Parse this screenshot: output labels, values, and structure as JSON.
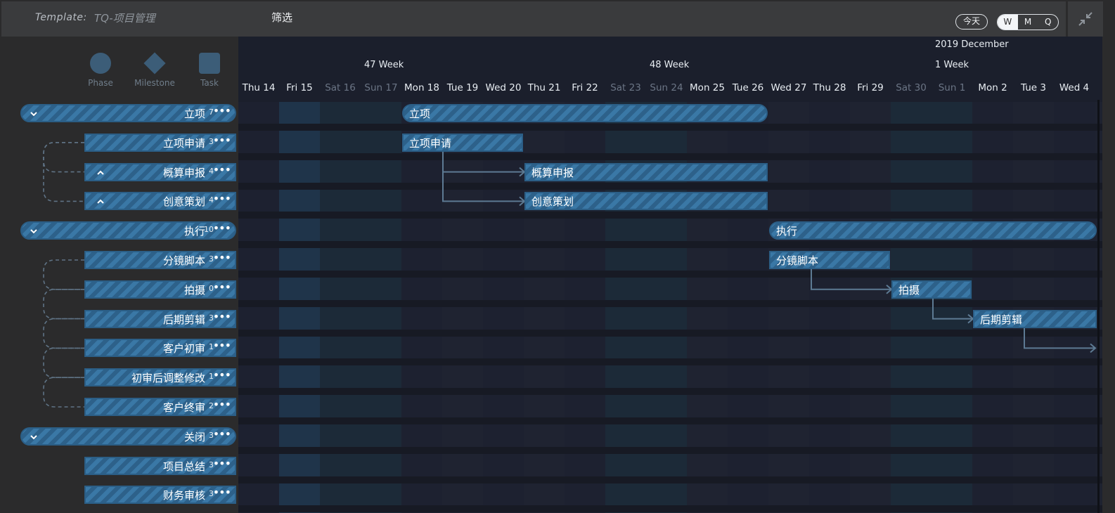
{
  "topbar": {
    "template_label": "Template:",
    "template_name": "TQ-项目管理",
    "filter_label": "筛选",
    "today_label": "今天",
    "view_modes": [
      "W",
      "M",
      "Q"
    ],
    "active_view": "W"
  },
  "legend": {
    "phase": "Phase",
    "milestone": "Milestone",
    "task": "Task"
  },
  "timeline": {
    "weeks": [
      {
        "label": "47 Week"
      },
      {
        "label": "48 Week"
      },
      {
        "label": "2019 December"
      },
      {
        "label": "1 Week"
      }
    ],
    "days": [
      {
        "label": "Thu 14",
        "weekend": false
      },
      {
        "label": "Fri 15",
        "weekend": false
      },
      {
        "label": "Sat 16",
        "weekend": true
      },
      {
        "label": "Sun 17",
        "weekend": true
      },
      {
        "label": "Mon 18",
        "weekend": false
      },
      {
        "label": "Tue 19",
        "weekend": false
      },
      {
        "label": "Wed 20",
        "weekend": false
      },
      {
        "label": "Thu 21",
        "weekend": false
      },
      {
        "label": "Fri 22",
        "weekend": false
      },
      {
        "label": "Sat 23",
        "weekend": true
      },
      {
        "label": "Sun 24",
        "weekend": true
      },
      {
        "label": "Mon 25",
        "weekend": false
      },
      {
        "label": "Tue 26",
        "weekend": false
      },
      {
        "label": "Wed 27",
        "weekend": false
      },
      {
        "label": "Thu 28",
        "weekend": false
      },
      {
        "label": "Fri 29",
        "weekend": false
      },
      {
        "label": "Sat 30",
        "weekend": true
      },
      {
        "label": "Sun 1",
        "weekend": true
      },
      {
        "label": "Mon 2",
        "weekend": false
      },
      {
        "label": "Tue 3",
        "weekend": false
      },
      {
        "label": "Wed 4",
        "weekend": false
      }
    ],
    "today": "Fri 15"
  },
  "rows": [
    {
      "name": "立项",
      "count": "7",
      "type": "phase",
      "toggle": "collapse"
    },
    {
      "name": "立项申请",
      "count": "3",
      "type": "task"
    },
    {
      "name": "概算申报",
      "count": "4",
      "type": "task",
      "toggle": "expand"
    },
    {
      "name": "创意策划",
      "count": "4",
      "type": "task",
      "toggle": "expand"
    },
    {
      "name": "执行",
      "count": "10",
      "type": "phase",
      "toggle": "collapse"
    },
    {
      "name": "分镜脚本",
      "count": "3",
      "type": "task"
    },
    {
      "name": "拍摄",
      "count": "0",
      "type": "task"
    },
    {
      "name": "后期剪辑",
      "count": "3",
      "type": "task"
    },
    {
      "name": "客户初审",
      "count": "1",
      "type": "task"
    },
    {
      "name": "初审后调整修改",
      "count": "1",
      "type": "task"
    },
    {
      "name": "客户终审",
      "count": "2",
      "type": "task"
    },
    {
      "name": "关闭",
      "count": "3",
      "type": "phase",
      "toggle": "collapse"
    },
    {
      "name": "项目总结",
      "count": "3",
      "type": "task"
    },
    {
      "name": "财务审核",
      "count": "3",
      "type": "task"
    }
  ],
  "bars": [
    {
      "label": "立项",
      "row": 0,
      "start": "Mon 18",
      "end": "Tue 26",
      "type": "phase"
    },
    {
      "label": "立项申请",
      "row": 1,
      "start": "Mon 18",
      "end": "Wed 20",
      "type": "task"
    },
    {
      "label": "概算申报",
      "row": 2,
      "start": "Thu 21",
      "end": "Tue 26",
      "type": "task"
    },
    {
      "label": "创意策划",
      "row": 3,
      "start": "Thu 21",
      "end": "Tue 26",
      "type": "task"
    },
    {
      "label": "执行",
      "row": 4,
      "start": "Wed 27",
      "end": "Wed 4+",
      "type": "phase"
    },
    {
      "label": "分镜脚本",
      "row": 5,
      "start": "Wed 27",
      "end": "Fri 29",
      "type": "task"
    },
    {
      "label": "拍摄",
      "row": 6,
      "start": "Sat 30",
      "end": "Sun 1",
      "type": "task"
    },
    {
      "label": "后期剪辑",
      "row": 7,
      "start": "Mon 2",
      "end": "Wed 4+",
      "type": "task"
    }
  ]
}
